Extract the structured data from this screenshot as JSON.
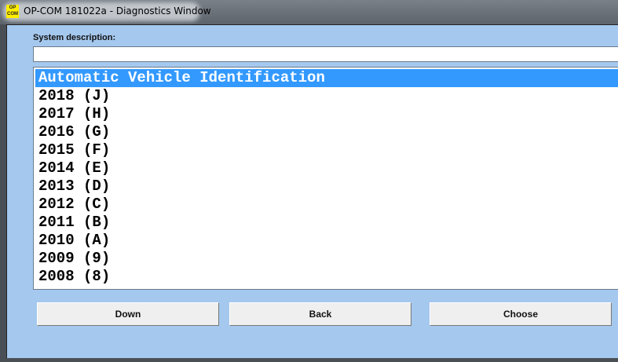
{
  "window": {
    "title": "OP-COM 181022a - Diagnostics Window",
    "icon_text": "OP COM"
  },
  "system_description_label": "System description:",
  "system_description_value": "",
  "list": {
    "items": [
      "Automatic Vehicle Identification",
      "2018 (J)",
      "2017 (H)",
      "2016 (G)",
      "2015 (F)",
      "2014 (E)",
      "2013 (D)",
      "2012 (C)",
      "2011 (B)",
      "2010 (A)",
      "2009 (9)",
      "2008 (8)"
    ],
    "selected_index": 0
  },
  "buttons": {
    "down": "Down",
    "back": "Back",
    "choose": "Choose"
  },
  "colors": {
    "selection": "#3399ff",
    "background": "#a5c8ee"
  }
}
